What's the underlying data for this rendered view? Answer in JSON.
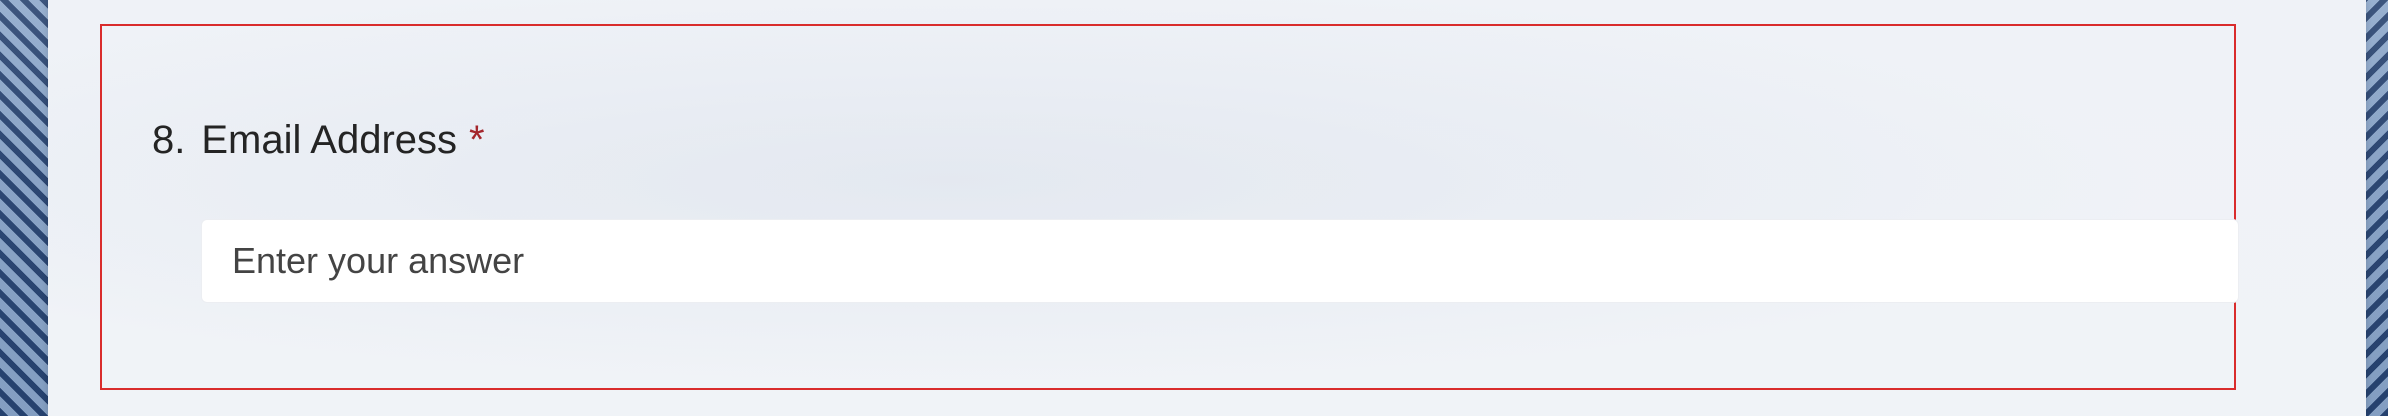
{
  "question": {
    "number": "8.",
    "title": "Email Address",
    "required_marker": "*",
    "answer": {
      "value": "",
      "placeholder": "Enter your answer"
    }
  },
  "colors": {
    "required": "#a4262c",
    "error_border": "#d92c2c",
    "background": "#f1f4f8"
  }
}
